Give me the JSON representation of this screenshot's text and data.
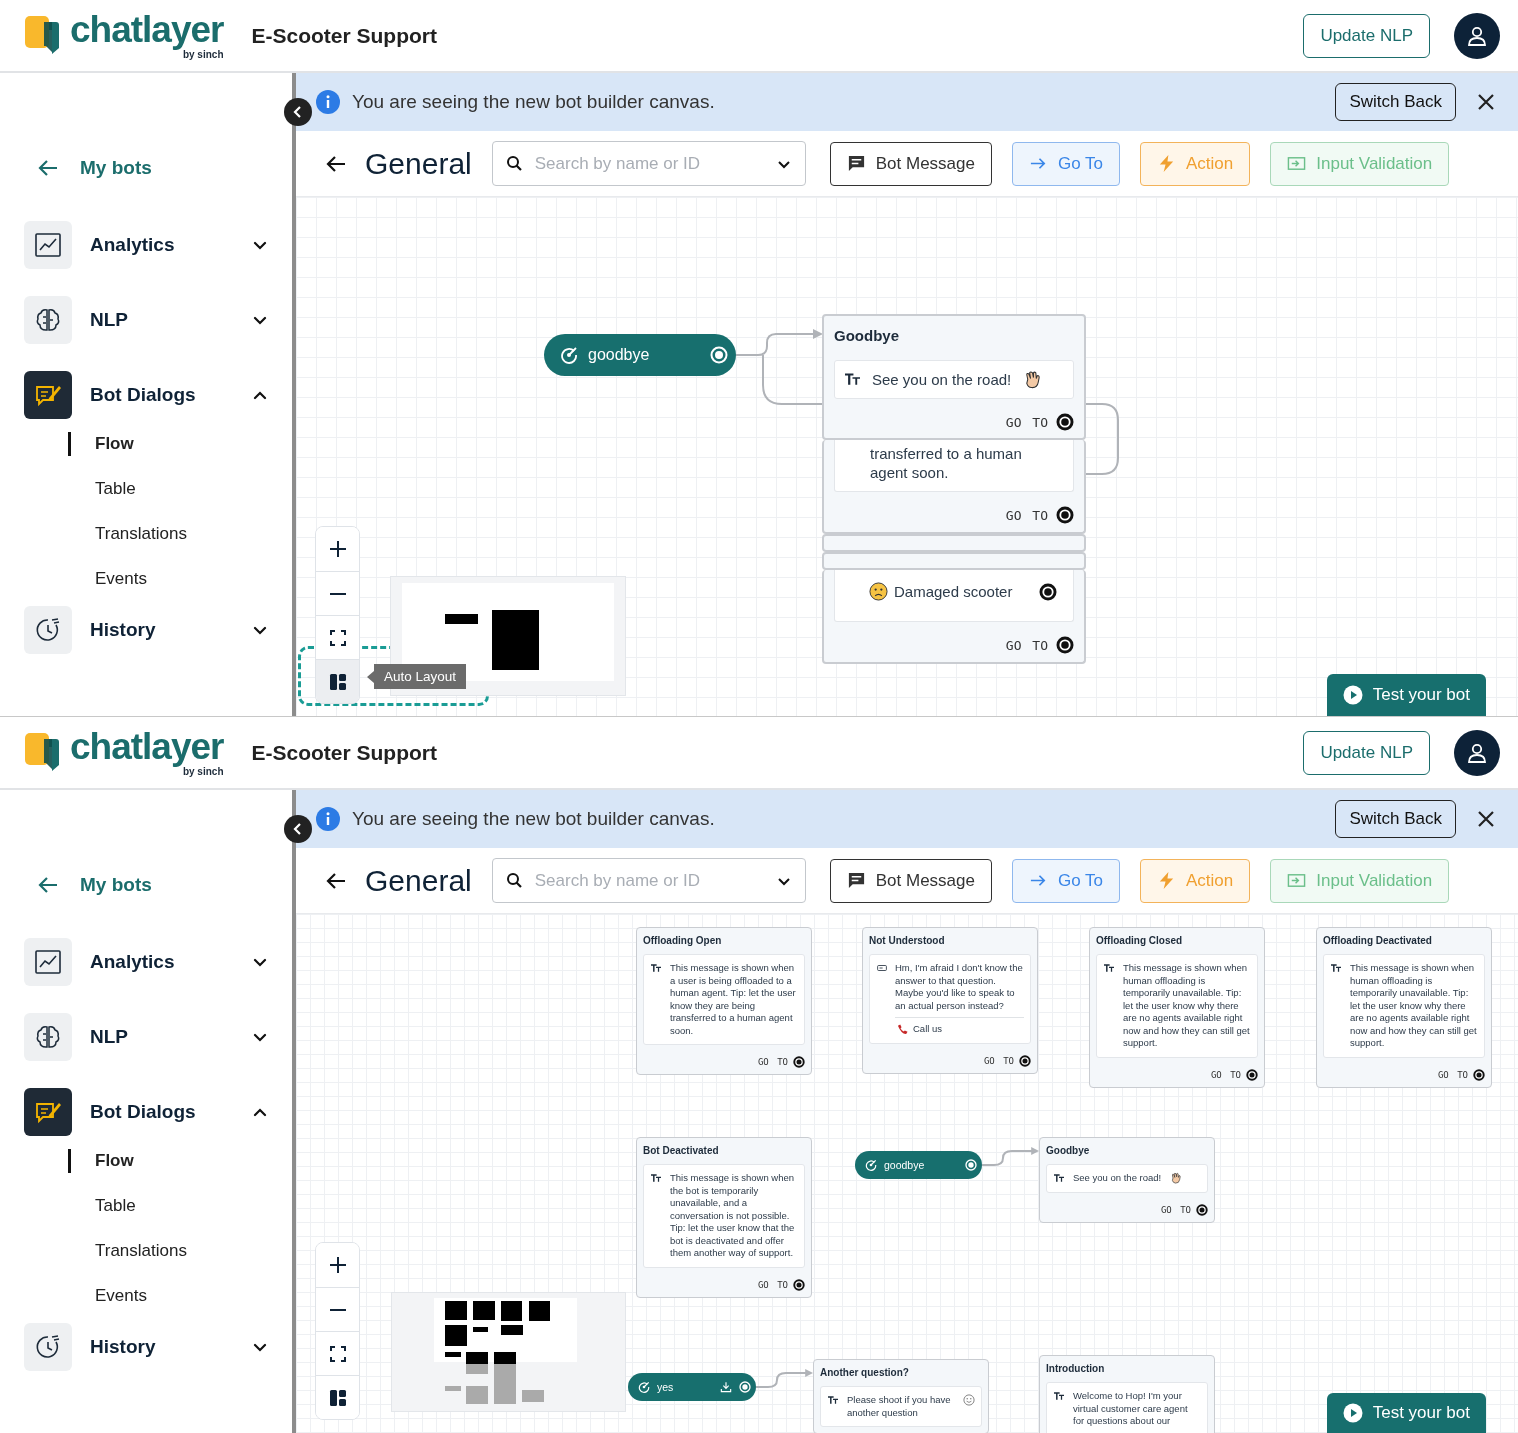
{
  "screens": [
    {
      "header": {
        "wordmark": "chatlayer",
        "byline": "by sinch",
        "bot_name": "E-Scooter Support",
        "update_button": "Update NLP"
      },
      "sidebar": {
        "back_link": "My bots",
        "items": [
          {
            "kind": "analytics",
            "label": "Analytics",
            "expanded": false
          },
          {
            "kind": "nlp",
            "label": "NLP",
            "expanded": false
          },
          {
            "kind": "dialogs",
            "label": "Bot Dialogs",
            "expanded": true,
            "children": [
              {
                "label": "Flow",
                "selected": true
              },
              {
                "label": "Table",
                "selected": false
              },
              {
                "label": "Translations",
                "selected": false
              },
              {
                "label": "Events",
                "selected": false
              }
            ]
          },
          {
            "kind": "history",
            "label": "History",
            "expanded": false
          }
        ]
      },
      "banner": {
        "text": "You are seeing the new bot builder canvas.",
        "button": "Switch Back"
      },
      "toolbar": {
        "title": "General",
        "search": {
          "placeholder": "Search by name or ID"
        },
        "buttons": [
          {
            "kind": "message",
            "label": "Bot Message"
          },
          {
            "kind": "goto",
            "label": "Go To"
          },
          {
            "kind": "action",
            "label": "Action"
          },
          {
            "kind": "validation",
            "label": "Input Validation"
          }
        ]
      },
      "canvas": {
        "tooltip": "Auto Layout",
        "test_button": "Test your bot",
        "nodes": [
          {
            "kind": "trigger",
            "label": "goodbye",
            "download": false
          },
          {
            "kind": "card",
            "title": "Goodbye",
            "messages": [
              {
                "kind": "text",
                "text": "See you on the road!",
                "emoji": {
                  "kind": "wave"
                }
              }
            ],
            "goto": "GO TO"
          },
          {
            "kind": "card",
            "messages": [
              {
                "kind": "text-partial",
                "text": "transferred to a human agent soon."
              }
            ],
            "goto": "GO TO"
          },
          {
            "kind": "sliver"
          },
          {
            "kind": "sliver"
          },
          {
            "kind": "card",
            "messages": [
              {
                "kind": "quick-reply",
                "text": "Damaged scooter",
                "emoji": {
                  "kind": "sad"
                }
              }
            ],
            "goto": "GO TO"
          }
        ]
      }
    },
    {
      "header": {
        "wordmark": "chatlayer",
        "byline": "by sinch",
        "bot_name": "E-Scooter Support",
        "update_button": "Update NLP"
      },
      "sidebar": {
        "back_link": "My bots",
        "items": [
          {
            "kind": "analytics",
            "label": "Analytics",
            "expanded": false
          },
          {
            "kind": "nlp",
            "label": "NLP",
            "expanded": false
          },
          {
            "kind": "dialogs",
            "label": "Bot Dialogs",
            "expanded": true,
            "children": [
              {
                "label": "Flow",
                "selected": true
              },
              {
                "label": "Table",
                "selected": false
              },
              {
                "label": "Translations",
                "selected": false
              },
              {
                "label": "Events",
                "selected": false
              }
            ]
          },
          {
            "kind": "history",
            "label": "History",
            "expanded": false
          }
        ]
      },
      "banner": {
        "text": "You are seeing the new bot builder canvas.",
        "button": "Switch Back"
      },
      "toolbar": {
        "title": "General",
        "search": {
          "placeholder": "Search by name or ID"
        },
        "buttons": [
          {
            "kind": "message",
            "label": "Bot Message"
          },
          {
            "kind": "goto",
            "label": "Go To"
          },
          {
            "kind": "action",
            "label": "Action"
          },
          {
            "kind": "validation",
            "label": "Input Validation"
          }
        ]
      },
      "canvas": {
        "test_button": "Test your bot",
        "nodes": [
          {
            "kind": "card",
            "title": "Offloading Open",
            "messages": [
              {
                "kind": "text",
                "text": "This message is shown when a user is being offloaded to a human agent. Tip: let the user know they are being transferred to a human agent soon."
              }
            ],
            "goto": "GO TO"
          },
          {
            "kind": "card",
            "title": "Not Understood",
            "messages": [
              {
                "kind": "fallback",
                "text": "Hm, I'm afraid I don't know the answer to that question. Maybe you'd like to speak to an actual person instead?",
                "button": "Call us"
              }
            ],
            "goto": "GO TO"
          },
          {
            "kind": "card",
            "title": "Offloading Closed",
            "messages": [
              {
                "kind": "text",
                "text": "This message is shown when human offloading is temporarily unavailable. Tip: let the user know why there are no agents available right now and how they can still get support."
              }
            ],
            "goto": "GO TO"
          },
          {
            "kind": "card",
            "title": "Offloading Deactivated",
            "messages": [
              {
                "kind": "text",
                "text": "This message is shown when human offloading is temporarily unavailable. Tip: let the user know why there are no agents available right now and how they can still get support."
              }
            ],
            "goto": "GO TO"
          },
          {
            "kind": "card",
            "title": "Bot Deactivated",
            "messages": [
              {
                "kind": "text",
                "text": "This message is shown when the bot is temporarily unavailable, and a conversation is not possible. Tip: let the user know that the bot is deactivated and offer them another way of support."
              }
            ],
            "goto": "GO TO"
          },
          {
            "kind": "trigger",
            "label": "goodbye",
            "download": false
          },
          {
            "kind": "card",
            "title": "Goodbye",
            "messages": [
              {
                "kind": "text",
                "text": "See you on the road!",
                "emoji": {
                  "kind": "wave"
                }
              }
            ],
            "goto": "GO TO"
          },
          {
            "kind": "trigger",
            "label": "yes",
            "download": true
          },
          {
            "kind": "card",
            "title": "Another question?",
            "messages": [
              {
                "kind": "text",
                "text": "Please shoot if you have another question",
                "emoji": {
                  "kind": "smile"
                }
              }
            ]
          },
          {
            "kind": "card",
            "title": "Introduction",
            "messages": [
              {
                "kind": "text",
                "text": "Welcome to Hop! I'm your virtual customer care agent for questions about our"
              }
            ]
          }
        ]
      }
    }
  ]
}
